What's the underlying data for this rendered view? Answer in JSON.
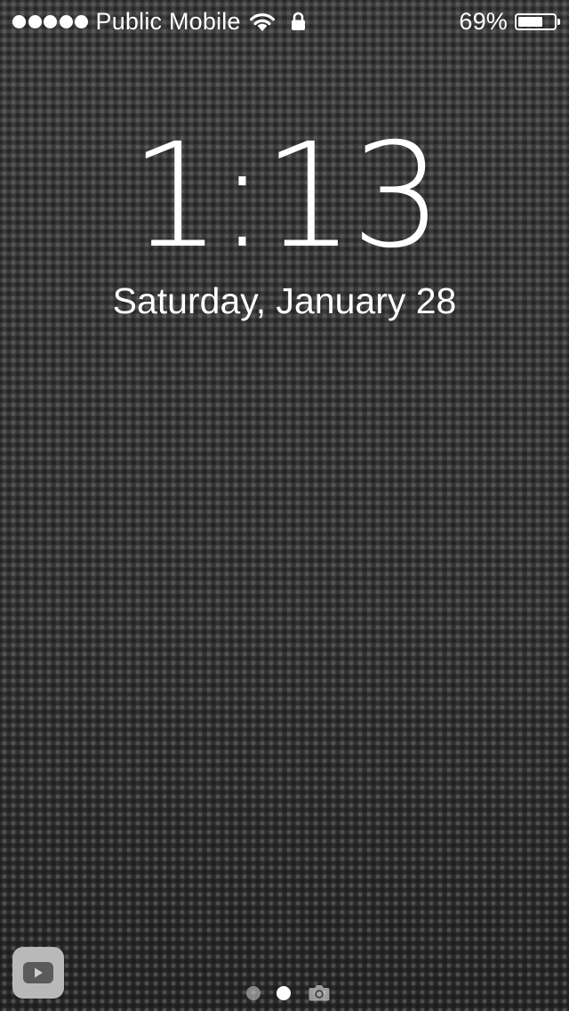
{
  "status_bar": {
    "signal_strength": 5,
    "carrier": "Public Mobile",
    "wifi_icon": "wifi-icon",
    "lock_icon": "lock-icon",
    "battery_percent_text": "69%",
    "battery_level": 0.69
  },
  "lock_screen": {
    "time": "1:13",
    "date": "Saturday, January 28"
  },
  "bottom": {
    "suggested_app_icon": "youtube-icon",
    "page_indicators": [
      {
        "name": "page-dot-widgets",
        "active": false
      },
      {
        "name": "page-dot-lockscreen",
        "active": true
      }
    ],
    "camera_icon": "camera-icon"
  }
}
